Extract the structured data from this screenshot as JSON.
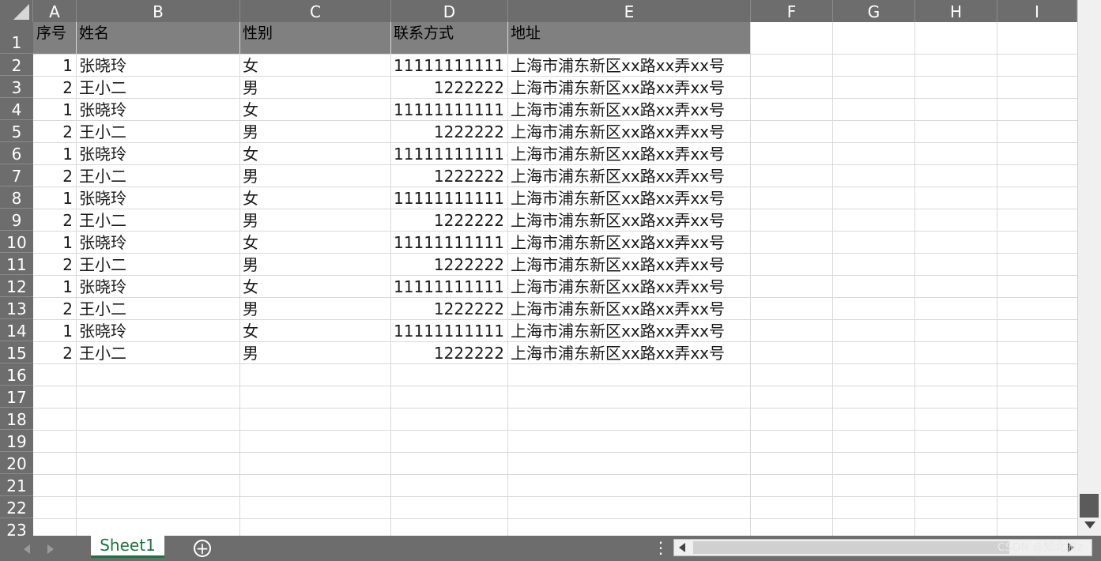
{
  "columns": [
    "A",
    "B",
    "C",
    "D",
    "E",
    "F",
    "G",
    "H",
    "I"
  ],
  "row_numbers": [
    "1",
    "2",
    "3",
    "4",
    "5",
    "6",
    "7",
    "8",
    "9",
    "10",
    "11",
    "12",
    "13",
    "14",
    "15",
    "16",
    "17",
    "18",
    "19",
    "20",
    "21",
    "22",
    "23"
  ],
  "table": {
    "headers": [
      "序号",
      "姓名",
      "性别",
      "联系方式",
      "地址"
    ],
    "rows": [
      [
        "1",
        "张晓玲",
        "女",
        "11111111111",
        "上海市浦东新区xx路xx弄xx号"
      ],
      [
        "2",
        "王小二",
        "男",
        "1222222",
        "上海市浦东新区xx路xx弄xx号"
      ],
      [
        "1",
        "张晓玲",
        "女",
        "11111111111",
        "上海市浦东新区xx路xx弄xx号"
      ],
      [
        "2",
        "王小二",
        "男",
        "1222222",
        "上海市浦东新区xx路xx弄xx号"
      ],
      [
        "1",
        "张晓玲",
        "女",
        "11111111111",
        "上海市浦东新区xx路xx弄xx号"
      ],
      [
        "2",
        "王小二",
        "男",
        "1222222",
        "上海市浦东新区xx路xx弄xx号"
      ],
      [
        "1",
        "张晓玲",
        "女",
        "11111111111",
        "上海市浦东新区xx路xx弄xx号"
      ],
      [
        "2",
        "王小二",
        "男",
        "1222222",
        "上海市浦东新区xx路xx弄xx号"
      ],
      [
        "1",
        "张晓玲",
        "女",
        "11111111111",
        "上海市浦东新区xx路xx弄xx号"
      ],
      [
        "2",
        "王小二",
        "男",
        "1222222",
        "上海市浦东新区xx路xx弄xx号"
      ],
      [
        "1",
        "张晓玲",
        "女",
        "11111111111",
        "上海市浦东新区xx路xx弄xx号"
      ],
      [
        "2",
        "王小二",
        "男",
        "1222222",
        "上海市浦东新区xx路xx弄xx号"
      ],
      [
        "1",
        "张晓玲",
        "女",
        "11111111111",
        "上海市浦东新区xx路xx弄xx号"
      ],
      [
        "2",
        "王小二",
        "男",
        "1222222",
        "上海市浦东新区xx路xx弄xx号"
      ]
    ]
  },
  "sheet_tab": {
    "label": "Sheet1"
  },
  "add_sheet": {
    "label": "+"
  },
  "more_menu": {
    "label": "⋮"
  },
  "watermark": "CSDN @知北游z",
  "colors": {
    "header_bar": "#6d6d6d",
    "header_row_fill": "#808080",
    "gridline": "#d9d9d9",
    "sheet_tab_accent": "#1e7145"
  }
}
